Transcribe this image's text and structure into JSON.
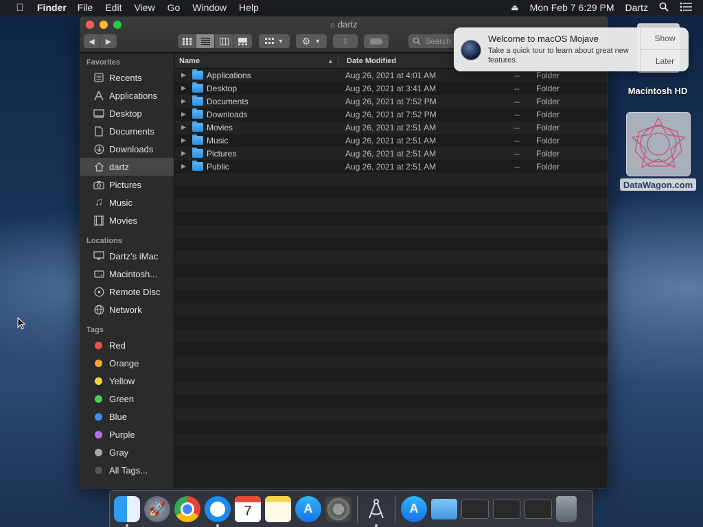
{
  "menubar": {
    "app_name": "Finder",
    "menus": [
      "File",
      "Edit",
      "View",
      "Go",
      "Window",
      "Help"
    ],
    "datetime": "Mon Feb 7  6:29 PM",
    "user": "Dartz"
  },
  "window": {
    "title": "dartz",
    "search_placeholder": "Search"
  },
  "sidebar": {
    "favorites_header": "Favorites",
    "favorites": [
      {
        "label": "Recents",
        "icon": "recents-icon"
      },
      {
        "label": "Applications",
        "icon": "applications-icon"
      },
      {
        "label": "Desktop",
        "icon": "desktop-icon"
      },
      {
        "label": "Documents",
        "icon": "documents-icon"
      },
      {
        "label": "Downloads",
        "icon": "downloads-icon"
      },
      {
        "label": "dartz",
        "icon": "home-icon",
        "selected": true
      },
      {
        "label": "Pictures",
        "icon": "camera-icon"
      },
      {
        "label": "Music",
        "icon": "music-note-icon"
      },
      {
        "label": "Movies",
        "icon": "film-icon"
      }
    ],
    "locations_header": "Locations",
    "locations": [
      {
        "label": "Dartz’s iMac",
        "icon": "imac-icon"
      },
      {
        "label": "Macintosh...",
        "icon": "disk-icon"
      },
      {
        "label": "Remote Disc",
        "icon": "disc-icon"
      },
      {
        "label": "Network",
        "icon": "globe-icon"
      }
    ],
    "tags_header": "Tags",
    "tags": [
      {
        "label": "Red",
        "color": "#f0504a"
      },
      {
        "label": "Orange",
        "color": "#f5a531"
      },
      {
        "label": "Yellow",
        "color": "#f5d330"
      },
      {
        "label": "Green",
        "color": "#48d15c"
      },
      {
        "label": "Blue",
        "color": "#3a8ef6"
      },
      {
        "label": "Purple",
        "color": "#b86ee6"
      },
      {
        "label": "Gray",
        "color": "#a8a8a8"
      },
      {
        "label": "All Tags...",
        "color": "#555555"
      }
    ]
  },
  "list": {
    "columns": {
      "name": "Name",
      "date": "Date Modified"
    },
    "rows": [
      {
        "name": "Applications",
        "date": "Aug 26, 2021 at 4:01 AM",
        "size": "--",
        "kind": "Folder"
      },
      {
        "name": "Desktop",
        "date": "Aug 26, 2021 at 3:41 AM",
        "size": "--",
        "kind": "Folder"
      },
      {
        "name": "Documents",
        "date": "Aug 26, 2021 at 7:52 PM",
        "size": "--",
        "kind": "Folder"
      },
      {
        "name": "Downloads",
        "date": "Aug 26, 2021 at 7:52 PM",
        "size": "--",
        "kind": "Folder"
      },
      {
        "name": "Movies",
        "date": "Aug 26, 2021 at 2:51 AM",
        "size": "--",
        "kind": "Folder"
      },
      {
        "name": "Music",
        "date": "Aug 26, 2021 at 2:51 AM",
        "size": "--",
        "kind": "Folder"
      },
      {
        "name": "Pictures",
        "date": "Aug 26, 2021 at 2:51 AM",
        "size": "--",
        "kind": "Folder"
      },
      {
        "name": "Public",
        "date": "Aug 26, 2021 at 2:51 AM",
        "size": "--",
        "kind": "Folder"
      }
    ]
  },
  "notification": {
    "title": "Welcome to macOS Mojave",
    "body": "Take a quick tour to learn about great new features.",
    "show_label": "Show",
    "later_label": "Later"
  },
  "desktop": {
    "hd_label": "Macintosh HD",
    "datawagon_label": "DataWagon.com"
  },
  "dock": {
    "calendar_day": "7"
  }
}
